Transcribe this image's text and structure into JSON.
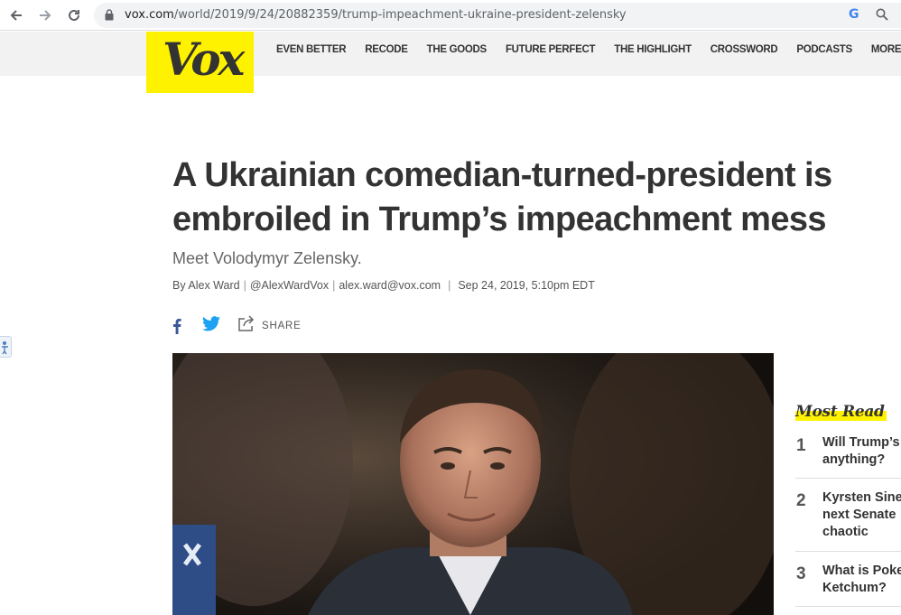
{
  "browser": {
    "url_domain": "vox.com",
    "url_path": "/world/2019/9/24/20882359/trump-impeachment-ukraine-president-zelensky"
  },
  "site": {
    "logo": "Vox",
    "nav": [
      "EVEN BETTER",
      "RECODE",
      "THE GOODS",
      "FUTURE PERFECT",
      "THE HIGHLIGHT",
      "CROSSWORD",
      "PODCASTS",
      "MORE"
    ]
  },
  "article": {
    "headline_line1": "A Ukrainian comedian-turned-president is",
    "headline_line2": "embroiled in Trump’s impeachment mess",
    "dek": "Meet Volodymyr Zelensky.",
    "byline_prefix": "By",
    "author": "Alex Ward",
    "twitter": "@AlexWardVox",
    "email": "alex.ward@vox.com",
    "timestamp": "Sep 24, 2019, 5:10pm EDT",
    "share_label": "SHARE"
  },
  "most_read": {
    "title": "Most Read",
    "items": [
      {
        "num": "1",
        "line1": "Will Trump’s",
        "line2": "anything?"
      },
      {
        "num": "2",
        "line1": "Kyrsten Sine",
        "line2": "next Senate",
        "line3": "chaotic"
      },
      {
        "num": "3",
        "line1": "What is Poke",
        "line2": "Ketchum?"
      }
    ]
  },
  "colors": {
    "brand_yellow": "#fff200",
    "facebook": "#3b5998",
    "twitter": "#1da1f2"
  }
}
